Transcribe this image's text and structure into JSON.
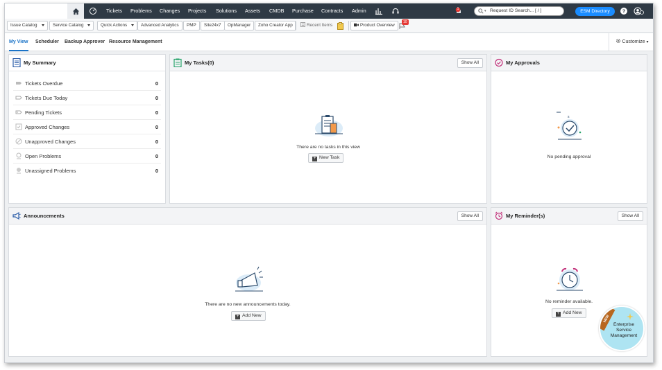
{
  "nav": {
    "items": [
      "Tickets",
      "Problems",
      "Changes",
      "Projects",
      "Solutions",
      "Assets",
      "CMDB",
      "Purchase",
      "Contracts",
      "Admin"
    ],
    "search_placeholder": "Request ID Search... [ / ]",
    "esm_directory": "ESM Directory",
    "notification_count": "1"
  },
  "toolbar": {
    "issue_catalog": "Issue Catalog",
    "service_catalog": "Service Catalog",
    "quick_actions": "Quick Actions",
    "advanced_analytics": "Advanced Analytics",
    "pmp": "PMP",
    "site24x7": "Site24x7",
    "opmanager": "OpManager",
    "zoho_creator": "Zoho Creator App",
    "recent_items": "Recent Items",
    "product_overview": "Product Overview",
    "product_overview_badge": "10"
  },
  "tabs": [
    "My View",
    "Scheduler",
    "Backup Approver",
    "Resource Management"
  ],
  "customize": "Customize",
  "summary": {
    "title": "My Summary",
    "rows": [
      {
        "label": "Tickets Overdue",
        "count": "0"
      },
      {
        "label": "Tickets Due Today",
        "count": "0"
      },
      {
        "label": "Pending Tickets",
        "count": "0"
      },
      {
        "label": "Approved Changes",
        "count": "0"
      },
      {
        "label": "Unapproved Changes",
        "count": "0"
      },
      {
        "label": "Open Problems",
        "count": "0"
      },
      {
        "label": "Unassigned Problems",
        "count": "0"
      }
    ]
  },
  "tasks": {
    "title": "My Tasks(0)",
    "show_all": "Show All",
    "empty": "There are no tasks in this view",
    "new_task": "New Task"
  },
  "approvals": {
    "title": "My Approvals",
    "empty": "No pending approval"
  },
  "announcements": {
    "title": "Announcements",
    "show_all": "Show All",
    "empty": "There are no new announcements today.",
    "add_new": "Add New"
  },
  "reminders": {
    "title": "My Reminder(s)",
    "show_all": "Show All",
    "empty": "No reminder available.",
    "add_new": "Add New"
  },
  "esm_badge": {
    "ribbon": "NEW",
    "line1": "Enterprise",
    "line2": "Service",
    "line3": "Management"
  },
  "colors": {
    "nav_bg": "#2f3a45",
    "accent": "#1a73c7",
    "esm_button": "#1a8cff"
  }
}
